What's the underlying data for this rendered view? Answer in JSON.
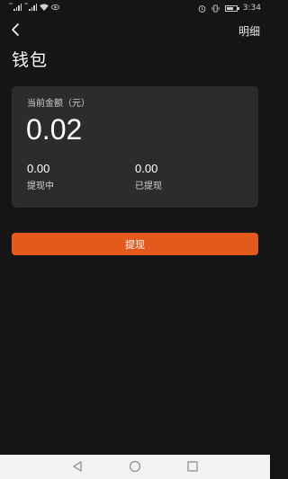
{
  "status_bar": {
    "time": "3:34",
    "battery_level": 0.75
  },
  "header": {
    "back_icon": "chevron-left-icon",
    "detail_link": "明细",
    "title": "钱包"
  },
  "balance_card": {
    "label": "当前金额（元）",
    "amount": "0.02",
    "stats": [
      {
        "value": "0.00",
        "label": "提现中"
      },
      {
        "value": "0.00",
        "label": "已提现"
      }
    ]
  },
  "actions": {
    "withdraw_label": "提现",
    "withdraw_color": "#e35a1c"
  },
  "nav_bar": {
    "icons": [
      "back-triangle-icon",
      "home-circle-icon",
      "recents-square-icon"
    ]
  }
}
